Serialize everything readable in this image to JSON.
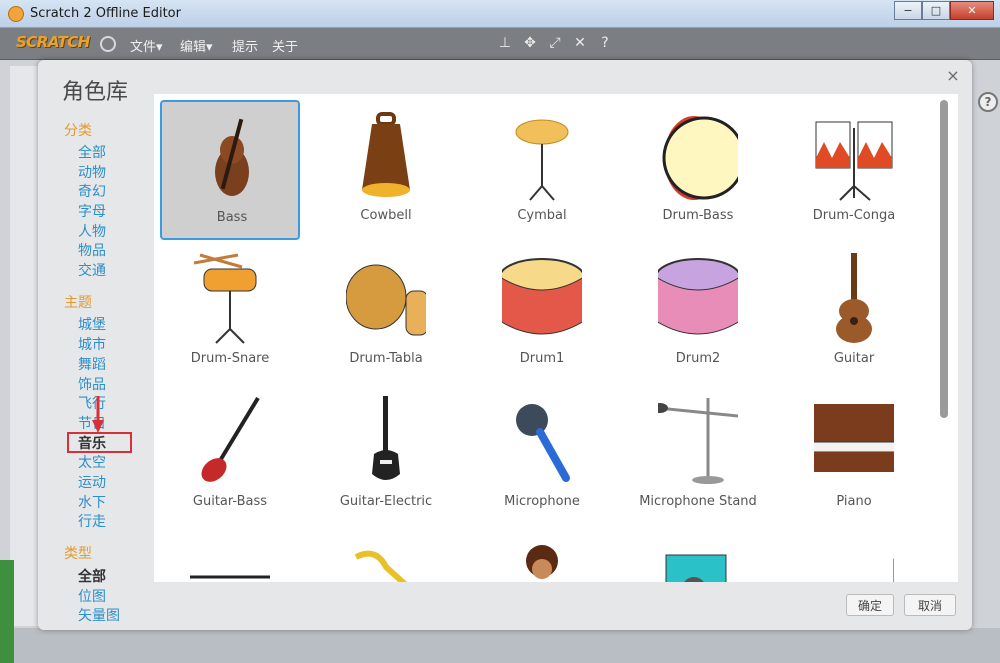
{
  "window": {
    "title": "Scratch 2 Offline Editor",
    "minimize": "−",
    "maximize": "□",
    "close": "✕"
  },
  "menubar": {
    "logo": "SCRATCH",
    "file": "文件▾",
    "edit": "编辑▾",
    "tips": "提示",
    "about": "关于"
  },
  "dialog": {
    "title": "角色库",
    "close": "×",
    "ok_button": "确定",
    "cancel_button": "取消"
  },
  "sidebar": {
    "categories_heading": "分类",
    "categories": [
      "全部",
      "动物",
      "奇幻",
      "字母",
      "人物",
      "物品",
      "交通"
    ],
    "themes_heading": "主题",
    "themes": [
      "城堡",
      "城市",
      "舞蹈",
      "饰品",
      "飞行",
      "节日",
      "音乐",
      "太空",
      "运动",
      "水下",
      "行走"
    ],
    "selected_theme": "音乐",
    "types_heading": "类型",
    "types": [
      "全部",
      "位图",
      "矢量图"
    ],
    "selected_type": "全部"
  },
  "sprites": [
    {
      "name": "Bass",
      "selected": true
    },
    {
      "name": "Cowbell",
      "selected": false
    },
    {
      "name": "Cymbal",
      "selected": false
    },
    {
      "name": "Drum-Bass",
      "selected": false
    },
    {
      "name": "Drum-Conga",
      "selected": false
    },
    {
      "name": "Drum-Snare",
      "selected": false
    },
    {
      "name": "Drum-Tabla",
      "selected": false
    },
    {
      "name": "Drum1",
      "selected": false
    },
    {
      "name": "Drum2",
      "selected": false
    },
    {
      "name": "Guitar",
      "selected": false
    },
    {
      "name": "Guitar-Bass",
      "selected": false
    },
    {
      "name": "Guitar-Electric",
      "selected": false
    },
    {
      "name": "Microphone",
      "selected": false
    },
    {
      "name": "Microphone Stand",
      "selected": false
    },
    {
      "name": "Piano",
      "selected": false
    }
  ],
  "colors": {
    "accent_orange": "#e29b30",
    "link_blue": "#2d8fc9",
    "selected_border": "#3c9be0",
    "highlight_red": "#d8303a"
  }
}
